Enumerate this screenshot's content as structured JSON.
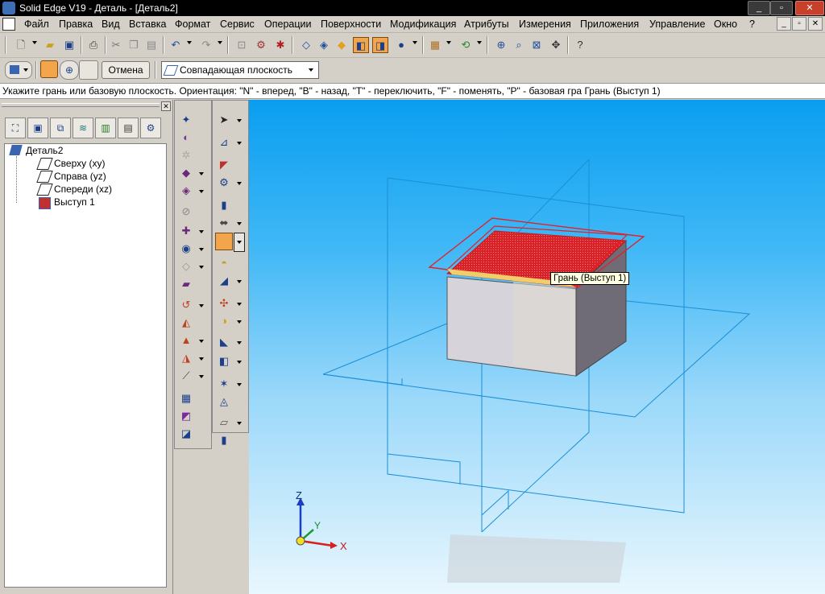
{
  "window": {
    "title": "Solid Edge V19 - Деталь - [Деталь2]",
    "controls": [
      "_",
      "▫",
      "✕"
    ]
  },
  "menu": {
    "items": [
      "Файл",
      "Правка",
      "Вид",
      "Вставка",
      "Формат",
      "Сервис",
      "Операции",
      "Поверхности",
      "Модификация",
      "Атрибуты",
      "Измерения",
      "Приложения",
      "Управление",
      "Окно",
      "?"
    ],
    "mdi_controls": [
      "_",
      "▫",
      "✕"
    ]
  },
  "ribbon": {
    "cancel_label": "Отмена",
    "plane_select": "Совпадающая плоскость"
  },
  "prompt": "Укажите грань или базовую плоскость. Ориентация: \"N\" - вперед, \"B\" - назад, \"T\" - переключить, \"F\" - поменять, \"P\" - базовая гра Грань (Выступ 1)",
  "tree": {
    "root": "Деталь2",
    "items": [
      "Сверху (xy)",
      "Справа (yz)",
      "Спереди (xz)",
      "Выступ 1"
    ]
  },
  "viewport": {
    "tooltip": "Грань (Выступ 1)",
    "axes": {
      "x": "X",
      "y": "Y",
      "z": "Z"
    }
  },
  "colors": {
    "sky_top": "#0a9ef0",
    "sky_bottom": "#e9f7fe",
    "plane_line": "#1a8fd6",
    "highlight_face": "#d8222a",
    "box_front": "#d6d4da",
    "box_side": "#6f6c78",
    "pressed_button": "#f2a54a"
  }
}
